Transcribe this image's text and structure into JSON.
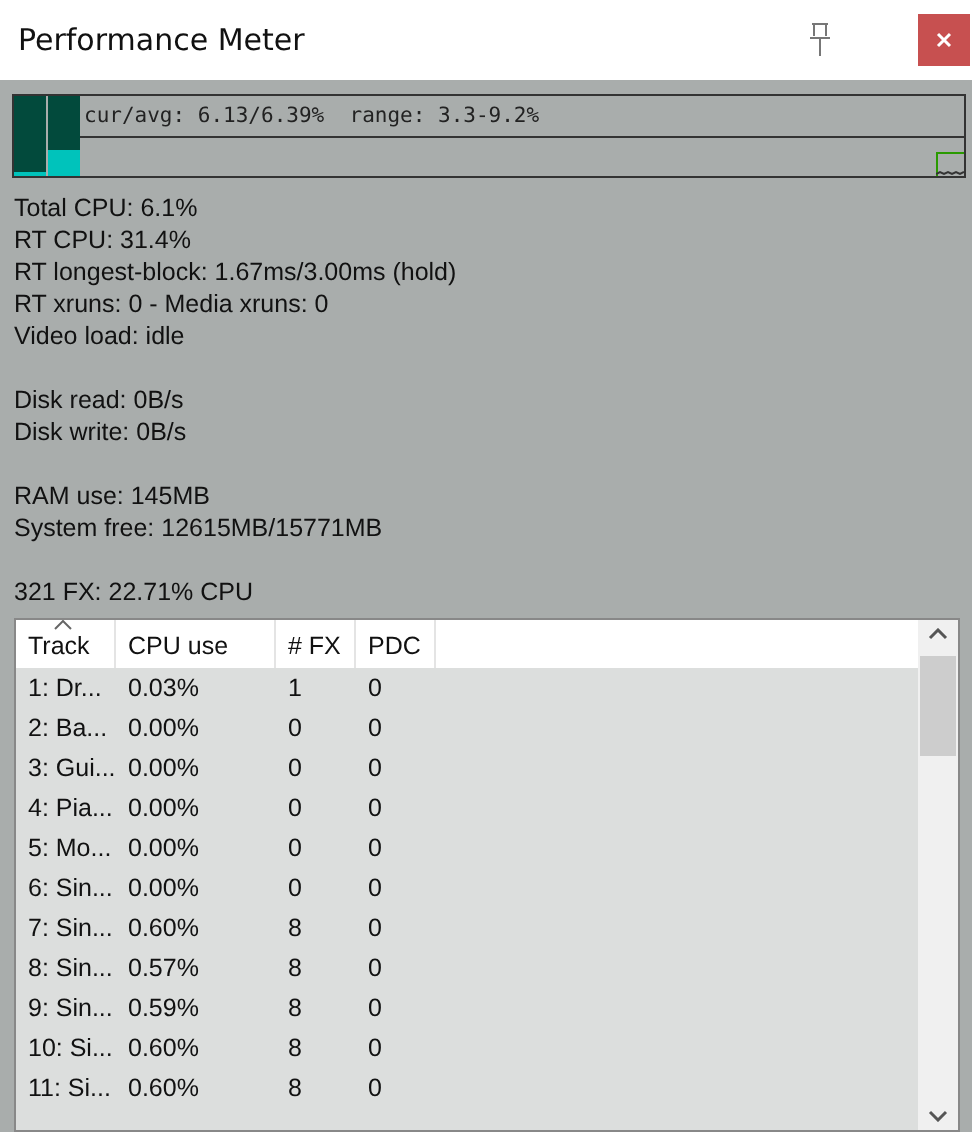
{
  "window": {
    "title": "Performance Meter"
  },
  "meter": {
    "label": "cur/avg: 6.13/6.39%  range: 3.3-9.2%",
    "bars": [
      {
        "level": 0.06
      },
      {
        "level": 0.33
      }
    ]
  },
  "stats": [
    [
      "Total CPU: 6.1%",
      "RT CPU: 31.4%",
      "RT longest-block: 1.67ms/3.00ms (hold)",
      "RT xruns: 0 - Media xruns: 0",
      "Video load: idle"
    ],
    [
      "Disk read: 0B/s",
      "Disk write: 0B/s"
    ],
    [
      "RAM use: 145MB",
      "System free: 12615MB/15771MB"
    ],
    [
      "321 FX: 22.71% CPU"
    ]
  ],
  "table": {
    "columns": [
      {
        "label": "Track",
        "sorted": true
      },
      {
        "label": "CPU use",
        "sorted": false
      },
      {
        "label": "# FX",
        "sorted": false
      },
      {
        "label": "PDC",
        "sorted": false
      }
    ],
    "rows": [
      [
        "1: Dr...",
        "0.03%",
        "1",
        "0"
      ],
      [
        "2: Ba...",
        "0.00%",
        "0",
        "0"
      ],
      [
        "3: Gui...",
        "0.00%",
        "0",
        "0"
      ],
      [
        "4: Pia...",
        "0.00%",
        "0",
        "0"
      ],
      [
        "5: Mo...",
        "0.00%",
        "0",
        "0"
      ],
      [
        "6: Sin...",
        "0.00%",
        "0",
        "0"
      ],
      [
        "7: Sin...",
        "0.60%",
        "8",
        "0"
      ],
      [
        "8: Sin...",
        "0.57%",
        "8",
        "0"
      ],
      [
        "9: Sin...",
        "0.59%",
        "8",
        "0"
      ],
      [
        "10: Si...",
        "0.60%",
        "8",
        "0"
      ],
      [
        "11: Si...",
        "0.60%",
        "8",
        "0"
      ]
    ]
  }
}
